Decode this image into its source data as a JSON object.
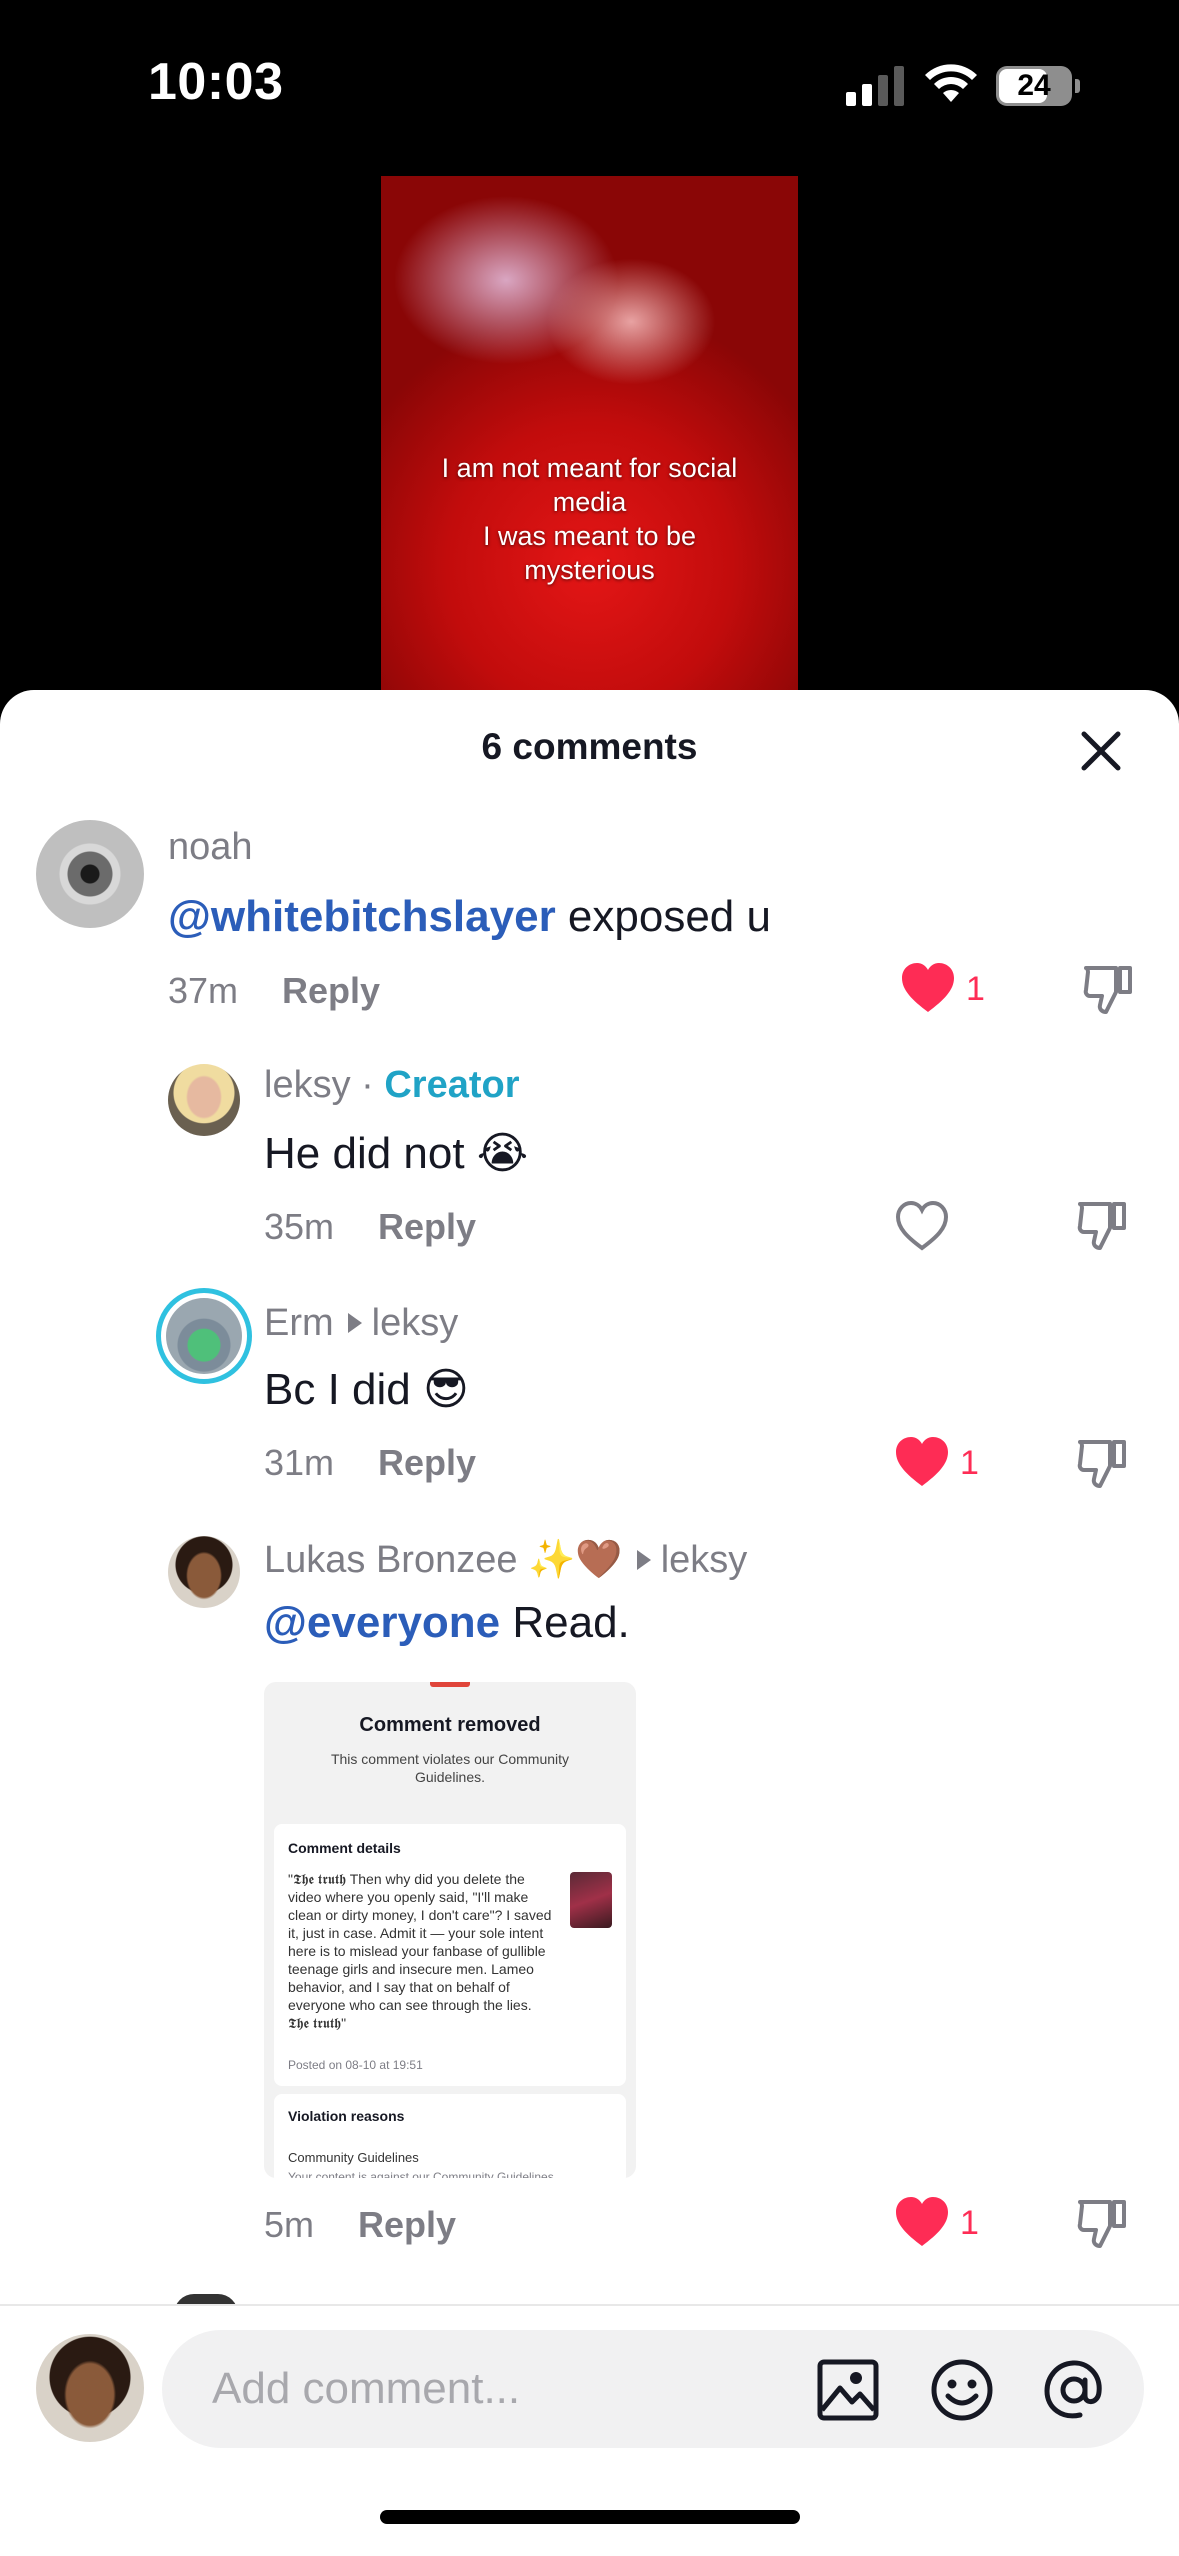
{
  "status_bar": {
    "time": "10:03",
    "battery": "24"
  },
  "video": {
    "caption": "I am not meant for social\nmedia\nI was meant to be\nmysterious"
  },
  "comments_header": {
    "title": "6 comments"
  },
  "comments": [
    {
      "username": "noah",
      "mention": "@whitebitchslayer",
      "text": " exposed u",
      "time": "37m",
      "reply": "Reply",
      "liked": true,
      "likes": "1"
    },
    {
      "username": "leksy",
      "tag": "Creator",
      "text": "He did not 😭",
      "time": "35m",
      "reply": "Reply",
      "liked": false
    },
    {
      "username": "Erm",
      "reply_to": "leksy",
      "text": "Bc I did 😎",
      "time": "31m",
      "reply": "Reply",
      "liked": true,
      "likes": "1"
    },
    {
      "username": "Lukas Bronzee ✨🤎",
      "reply_to": "leksy",
      "mention": "@everyone",
      "text": " Read.",
      "time": "5m",
      "reply": "Reply",
      "liked": true,
      "likes": "1"
    }
  ],
  "removed_card": {
    "title": "Comment removed",
    "subtitle": "This comment violates our Community Guidelines.",
    "details_heading": "Comment details",
    "details_body": "\"𝕿𝖍𝖊 𝖙𝖗𝖚𝖙𝖍 Then why did you delete the video where you openly said, \"I'll make clean or dirty money, I don't care\"? I saved it, just in case. Admit it — your sole intent here is to mislead your fanbase of gullible teenage girls and insecure men. Lameo behavior, and I say that on behalf of everyone who can see through the lies. 𝕿𝖍𝖊 𝖙𝖗𝖚𝖙𝖍\"",
    "posted": "Posted on 08-10 at 19:51",
    "violation_heading": "Violation reasons",
    "violation_reason": "Community Guidelines",
    "violation_detail": "Your content is against our Community Guidelines."
  },
  "input": {
    "placeholder": "Add comment..."
  },
  "colors": {
    "like": "#fe2c55",
    "mention": "#2b5db9",
    "creator": "#20a3c6",
    "meta": "#7d7d85"
  }
}
